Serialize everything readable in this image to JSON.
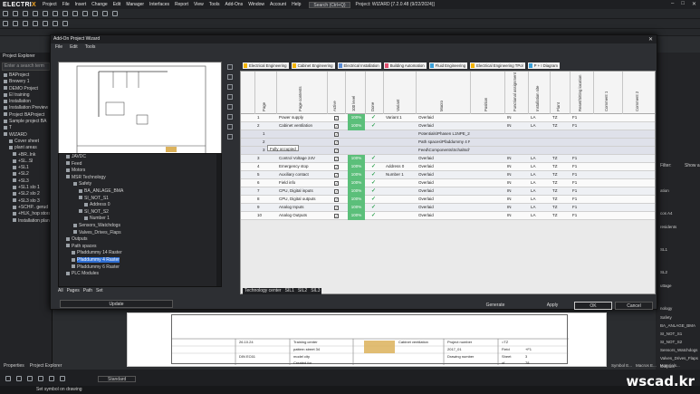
{
  "app": {
    "logo_a": "ELECTRI",
    "logo_b": "X",
    "search": "Search (Ctrl+Q)",
    "project_title": "Project: WIZARD [7.2.0.48 (9/22/2024)]"
  },
  "menu": [
    "Project",
    "File",
    "Insert",
    "Change",
    "Edit",
    "Manager",
    "Interfaces",
    "Report",
    "View",
    "Tools",
    "Add-Ons",
    "Window",
    "Account",
    "Help"
  ],
  "explorer": {
    "title": "Project Explorer",
    "search_placeholder": "Enter a search term",
    "items": [
      "BAProject",
      "Brewery 1",
      "DEMO Project",
      "EI training",
      "Installation",
      "Installation Preview",
      "Project BAProject",
      "Sample project BA",
      "T",
      "WIZARD",
      "Cover sheet",
      "plant areas",
      "+BR..Ink",
      "+SL..Sl",
      "+SL1",
      "+SL2",
      "+SL3",
      "+SL1 slo 1",
      "+SL2 slo 2",
      "+SL3 slo 3",
      "+SCHP.. gerud",
      "+HLK_hop storage",
      "Installation plan"
    ]
  },
  "dialog": {
    "title": "Add-On Project Wizard",
    "menu": [
      "File",
      "Edit",
      "Tools"
    ],
    "tree": [
      "JAVDC",
      "Feed",
      "Motors",
      "MSR Technology",
      "Safety",
      "BA_ANLAGE_BMA",
      "SI_NOT_S1",
      "Address 0",
      "SI_NOT_S2",
      "Number 1",
      "Sensors_Watchdogs",
      "Valves_Drives_Flaps",
      "Outputs",
      "Path spaces",
      "Pfaddummy 14 Raster",
      "Pfaddummy 4 Raster",
      "Pfaddummy 6 Raster",
      "PLC Modules"
    ],
    "tree_selected": "Pfaddummy 4 Raster",
    "tabs": [
      "All",
      "Pages",
      "Path",
      "Set"
    ],
    "update": "Update",
    "tags": [
      {
        "label": "Electrical Engineering",
        "color": "#f4b400"
      },
      {
        "label": "Cabinet Engineering",
        "color": "#f4b400"
      },
      {
        "label": "Electrical Installation",
        "color": "#5b8dd6"
      },
      {
        "label": "Building Automation",
        "color": "#e04f6f"
      },
      {
        "label": "Fluid Engineering",
        "color": "#3aa0d9"
      },
      {
        "label": "Electrical Engineering TPol",
        "color": "#f4b400"
      },
      {
        "label": "P + I Diagram",
        "color": "#3aa0d9"
      }
    ],
    "columns": [
      "",
      "Page",
      "Page contents",
      "Active",
      "100 level",
      "Done",
      "Variant",
      "Macro",
      "Position",
      "Functional assignment",
      "Installation site",
      "Plant",
      "Reset/Sitting location",
      "Comment 1",
      "Comment 2"
    ],
    "rows": [
      {
        "n": "1",
        "page": "Power supply",
        "active": true,
        "pct": "100%",
        "done": true,
        "variant": "Variant 1",
        "macro": "Overlaid",
        "fa": "IN",
        "site": "LA",
        "plant": "TZ",
        "loc": "F1",
        "kind": "main"
      },
      {
        "n": "2",
        "page": "Cabinet ventilation",
        "active": true,
        "pct": "100%",
        "done": true,
        "variant": "",
        "macro": "Overlaid",
        "fa": "IN",
        "site": "LA",
        "plant": "TZ",
        "loc": "F1",
        "kind": "main"
      },
      {
        "n": "1",
        "page": "",
        "active": true,
        "pct": "",
        "done": false,
        "variant": "",
        "macro": "Potentials\\Phasen L1NPE_230V vor HS",
        "fa": "",
        "site": "",
        "plant": "",
        "loc": "",
        "kind": "sub"
      },
      {
        "n": "2",
        "page": "",
        "active": true,
        "pct": "",
        "done": false,
        "variant": "",
        "macro": "Path spaces\\Pfaddummy 4 Raster",
        "fa": "",
        "site": "",
        "plant": "",
        "loc": "",
        "kind": "sub"
      },
      {
        "n": "3",
        "page": "",
        "active": true,
        "pct": "",
        "done": false,
        "variant": "",
        "macro": "Feed\\Components\\Schaltschranklüfter",
        "fa": "",
        "site": "",
        "plant": "",
        "loc": "",
        "kind": "sub"
      },
      {
        "n": "3",
        "page": "Control Voltage 24V",
        "active": true,
        "pct": "100%",
        "done": true,
        "variant": "",
        "macro": "Overlaid",
        "fa": "IN",
        "site": "LA",
        "plant": "TZ",
        "loc": "F1",
        "kind": "main"
      },
      {
        "n": "4",
        "page": "Emergency stop",
        "active": true,
        "pct": "100%",
        "done": true,
        "variant": "Address 0",
        "macro": "Overlaid",
        "fa": "IN",
        "site": "LA",
        "plant": "TZ",
        "loc": "F1",
        "kind": "main"
      },
      {
        "n": "5",
        "page": "Auxiliary contact",
        "active": true,
        "pct": "100%",
        "done": true,
        "variant": "Number 1",
        "macro": "Overlaid",
        "fa": "IN",
        "site": "LA",
        "plant": "TZ",
        "loc": "F1",
        "kind": "main"
      },
      {
        "n": "6",
        "page": "Field info",
        "active": true,
        "pct": "100%",
        "done": true,
        "variant": "",
        "macro": "Overlaid",
        "fa": "IN",
        "site": "LA",
        "plant": "TZ",
        "loc": "F1",
        "kind": "main"
      },
      {
        "n": "7",
        "page": "CPU, Digital inputs",
        "active": true,
        "pct": "100%",
        "done": true,
        "variant": "",
        "macro": "Overlaid",
        "fa": "IN",
        "site": "LA",
        "plant": "TZ",
        "loc": "F1",
        "kind": "main"
      },
      {
        "n": "8",
        "page": "CPU, Digital outputs",
        "active": true,
        "pct": "100%",
        "done": true,
        "variant": "",
        "macro": "Overlaid",
        "fa": "IN",
        "site": "LA",
        "plant": "TZ",
        "loc": "F1",
        "kind": "main"
      },
      {
        "n": "9",
        "page": "Analog Inputs",
        "active": true,
        "pct": "100%",
        "done": true,
        "variant": "",
        "macro": "Overlaid",
        "fa": "IN",
        "site": "LA",
        "plant": "TZ",
        "loc": "F1",
        "kind": "main"
      },
      {
        "n": "10",
        "page": "Analog Outputs",
        "active": true,
        "pct": "100%",
        "done": true,
        "variant": "",
        "macro": "Overlaid",
        "fa": "IN",
        "site": "LA",
        "plant": "TZ",
        "loc": "F1",
        "kind": "main"
      }
    ],
    "tooltip": "Fully occupied",
    "grid_tabs": [
      "Technology center",
      "SIL1",
      "SIL2",
      "SIL3"
    ],
    "generate": "Generate",
    "apply": "Apply",
    "ok": "OK",
    "cancel": "Cancel"
  },
  "drawing": {
    "date": "26.10.24",
    "page_label": "Cabinet ventilation",
    "training": "Training center",
    "street": "pattern street 34",
    "city": "model city",
    "norm": "DIN EC61",
    "created": "Created for",
    "proj_num": "Project number",
    "proj_val": "2017_01",
    "order": "Drawing number",
    "sheet": "Sheet",
    "sheet_val": "3",
    "of": "of",
    "of_val": "78",
    "field": "Field",
    "field_val": "+F1",
    "inst": "=TZ"
  },
  "rightpanel": {
    "filter": "Filter:",
    "show": "Show a",
    "items": [
      "ation",
      "cos A4",
      "residents",
      "SL1",
      "SL2",
      "uttage",
      "nology",
      "Safety",
      "BA_ANLAGE_BMA",
      "SI_NOT_S1",
      "SI_NOT_S2",
      "Sensors_Watchdogs",
      "Valves_Drives_Flaps",
      "Outputs"
    ]
  },
  "bottom": {
    "tabs": [
      "Properties",
      "Project Explorer"
    ],
    "status": "Set symbol on drawing",
    "right_tabs": [
      "Symbol E...",
      "Macros E...",
      "Materials..."
    ],
    "standard": "Standard",
    "watermark": "wscad.kr"
  }
}
